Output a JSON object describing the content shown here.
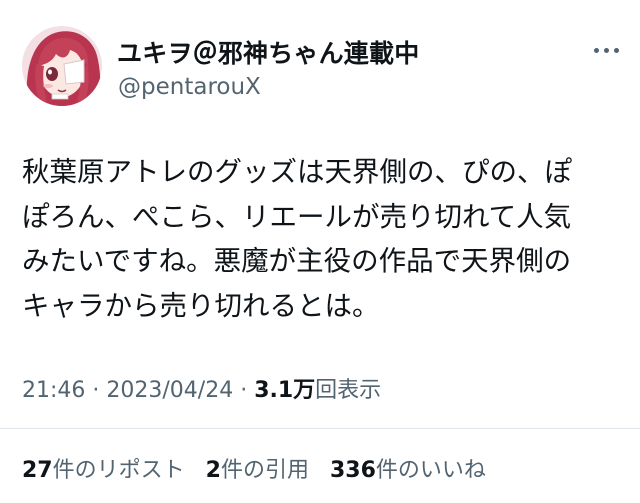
{
  "author": {
    "display_name": "ユキヲ＠邪神ちゃん連載中",
    "handle": "@pentarouX",
    "avatar_icon": "anime-girl-avatar-icon"
  },
  "more_icon": "more-horizontal-icon",
  "tweet": {
    "lines": [
      "秋葉原アトレのグッズは天界側の、ぴの、ぽ",
      "ぽろん、ぺこら、リエールが売り切れて人気",
      "みたいですね。悪魔が主役の作品で天界側の",
      "キャラから売り切れるとは。"
    ]
  },
  "meta": {
    "time": "21:46",
    "sep1": " · ",
    "date": "2023/04/24",
    "sep2": " · ",
    "views_count": "3.1万",
    "views_label": "回表示"
  },
  "stats": {
    "reposts_count": "27",
    "reposts_label": "件のリポスト",
    "quotes_count": "2",
    "quotes_label": "件の引用",
    "likes_count": "336",
    "likes_label": "件のいいね"
  },
  "colors": {
    "text_primary": "#0f1419",
    "text_secondary": "#536471",
    "divider": "#e1e6ea",
    "avatar_hair": "#c4415a",
    "avatar_bg": "#f4dde3"
  }
}
